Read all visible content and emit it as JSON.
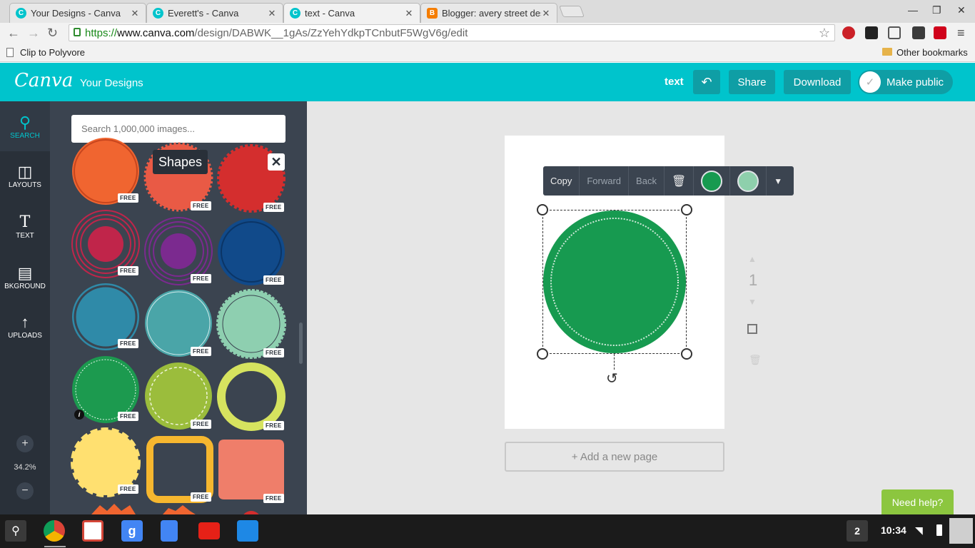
{
  "browser": {
    "tabs": [
      {
        "title": "Your Designs - Canva",
        "icon": "canva-icon",
        "active": false
      },
      {
        "title": "Everett's - Canva",
        "icon": "canva-icon",
        "active": false
      },
      {
        "title": "text - Canva",
        "icon": "canva-icon",
        "active": true
      },
      {
        "title": "Blogger: avery street des",
        "icon": "blogger-icon",
        "active": false
      }
    ],
    "url": {
      "scheme": "https://",
      "domain": "www.canva.com",
      "path": "/design/DABWK__1gAs/ZzYehYdkpTCnbutF5WgV6g/edit"
    },
    "bookmarks": {
      "left": "Clip to Polyvore",
      "right": "Other bookmarks"
    }
  },
  "header": {
    "logo": "Canva",
    "your_designs": "Your Designs",
    "design_name": "text",
    "share": "Share",
    "download": "Download",
    "make_public": "Make public"
  },
  "rail": {
    "items": [
      {
        "label": "SEARCH",
        "icon": "search-icon"
      },
      {
        "label": "LAYOUTS",
        "icon": "layouts-icon"
      },
      {
        "label": "TEXT",
        "icon": "text-icon"
      },
      {
        "label": "BKGROUND",
        "icon": "background-icon"
      },
      {
        "label": "UPLOADS",
        "icon": "upload-icon"
      }
    ],
    "zoom": "34.2%"
  },
  "panel": {
    "search_placeholder": "Search 1,000,000 images...",
    "tooltip": "Shapes",
    "free_label": "FREE",
    "shapes": [
      {
        "name": "orange-circle",
        "color": "#f06530"
      },
      {
        "name": "red-burst",
        "color": "#e95a45"
      },
      {
        "name": "crimson-scallop",
        "color": "#d42e2e"
      },
      {
        "name": "red-ring-circle",
        "color": "#c0254a"
      },
      {
        "name": "purple-ring-circle",
        "color": "#7b2a8f"
      },
      {
        "name": "navy-ring-circle",
        "color": "#114a8a"
      },
      {
        "name": "teal-circle",
        "color": "#2f8aa8"
      },
      {
        "name": "aqua-circle",
        "color": "#4aa5a8"
      },
      {
        "name": "mint-beaded-circle",
        "color": "#8ecfb0"
      },
      {
        "name": "green-stitched-circle",
        "color": "#1c9a4f"
      },
      {
        "name": "lime-stitched-circle",
        "color": "#9bbd3c"
      },
      {
        "name": "yellow-wavy-ring",
        "color": "#d6e35f"
      },
      {
        "name": "yellow-wavy-badge",
        "color": "#ffe070"
      },
      {
        "name": "orange-square-frame",
        "color": "#f6b72f"
      },
      {
        "name": "salmon-label",
        "color": "#ef7e6a"
      }
    ]
  },
  "canvas": {
    "toolbar": {
      "copy": "Copy",
      "forward": "Forward",
      "back": "Back",
      "color1": "#179a50",
      "color2": "#8ed0ac"
    },
    "shape_color": "#179a50",
    "page_number": "1",
    "add_page": "+ Add a new page",
    "need_help": "Need help?"
  },
  "taskbar": {
    "apps": [
      "chrome-icon",
      "gmail-icon",
      "google-icon",
      "docs-icon",
      "youtube-icon",
      "files-icon"
    ],
    "badge": "2",
    "time": "10:34"
  }
}
